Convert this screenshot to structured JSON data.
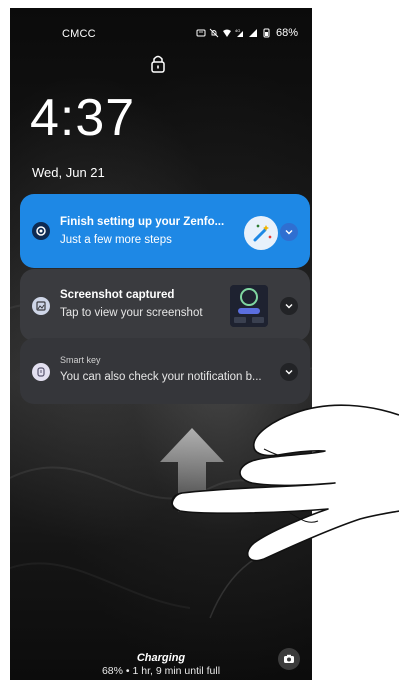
{
  "status_bar": {
    "carrier": "CMCC",
    "battery": "68%",
    "icons": [
      "message-icon",
      "mute-icon",
      "wifi-icon",
      "data-icon",
      "signal-icon",
      "battery-icon"
    ]
  },
  "lock": {
    "icon": "lock-icon"
  },
  "clock": {
    "time": "4:37",
    "date": "Wed, Jun 21"
  },
  "notifications": [
    {
      "title": "Finish setting up your Zenfo...",
      "text": "Just a few more steps",
      "icon": "gear-icon",
      "color": "#1e88e5"
    },
    {
      "title": "Screenshot captured",
      "text": "Tap to view your screenshot",
      "icon": "image-icon",
      "color": "#3a3b3f"
    },
    {
      "app": "Smart key",
      "text": "You can also check your notification b...",
      "icon": "smart-key-icon",
      "color": "#35363a"
    }
  ],
  "charging": {
    "title": "Charging",
    "subtitle": "68% • 1 hr, 9 min until full"
  },
  "camera": {
    "icon": "camera-icon"
  }
}
